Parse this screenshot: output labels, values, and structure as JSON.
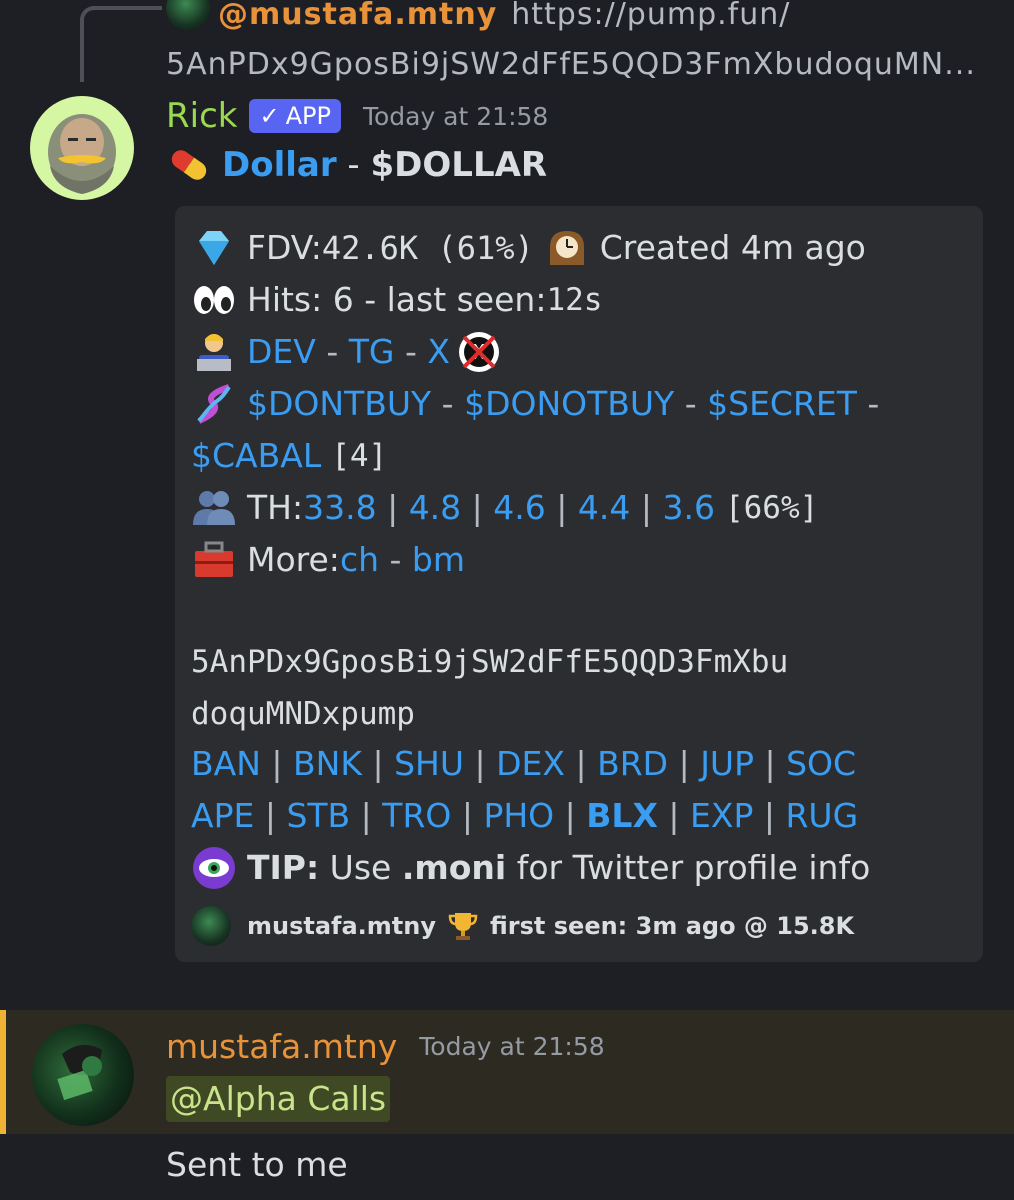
{
  "reply": {
    "username": "@mustafa.mtny",
    "text_line1": "https://pump.fun/",
    "text_line2": "5AnPDx9GposBi9jSW2dFfE5QQD3FmXbudoquMN..."
  },
  "message": {
    "username": "Rick",
    "badge": "APP",
    "badge_check": "✓",
    "timestamp": "Today at 21:58",
    "title_name": "Dollar",
    "title_sep": " - ",
    "title_ticker": "$DOLLAR"
  },
  "embed": {
    "fdv_label": "FDV: ",
    "fdv_value": "42.6K (61%)",
    "created": "Created 4m ago",
    "hits": "Hits: 6 - last seen: ",
    "hits_value": "12s",
    "dev_links": [
      "DEV",
      "TG",
      "X"
    ],
    "related_tickers": [
      "$DONTBUY",
      "$DONOTBUY",
      "$SECRET",
      "$CABAL"
    ],
    "related_count": "[4]",
    "th_label": "TH: ",
    "th_values": [
      "33.8",
      "4.8",
      "4.6",
      "4.4",
      "3.6"
    ],
    "th_total": "[66%]",
    "more_label": "More: ",
    "more_links": [
      "ch",
      "bm"
    ],
    "address_line1": "5AnPDx9GposBi9jSW2dFfE5QQD3FmXbu",
    "address_line2": "doquMNDxpump",
    "tools_row1": [
      "BAN",
      "BNK",
      "SHU",
      "DEX",
      "BRD",
      "JUP",
      "SOC"
    ],
    "tools_row2": [
      "APE",
      "STB",
      "TRO",
      "PHO",
      "BLX",
      "EXP",
      "RUG"
    ],
    "tip_label": "TIP:",
    "tip_pre": " Use ",
    "tip_cmd": ".moni",
    "tip_post": " for Twitter profile info",
    "footer_user": "mustafa.mtny",
    "footer_text": "first seen: 3m ago @ 15.8K"
  },
  "mention_message": {
    "username": "mustafa.mtny",
    "timestamp": "Today at 21:58",
    "mention": "@Alpha Calls"
  },
  "next_message": {
    "text": "Sent to me"
  },
  "icons": [
    "pill-icon",
    "diamond-icon",
    "clock-icon",
    "eyes-icon",
    "technologist-icon",
    "no-x-icon",
    "dna-icon",
    "group-icon",
    "toolbox-icon",
    "eye-icon",
    "trophy-icon"
  ],
  "colors": {
    "link": "#3a9df2",
    "app_badge": "#5865f2",
    "rick_name": "#9bd94f",
    "mustafa_name": "#e8923a",
    "highlight_bar": "#f0b232"
  }
}
